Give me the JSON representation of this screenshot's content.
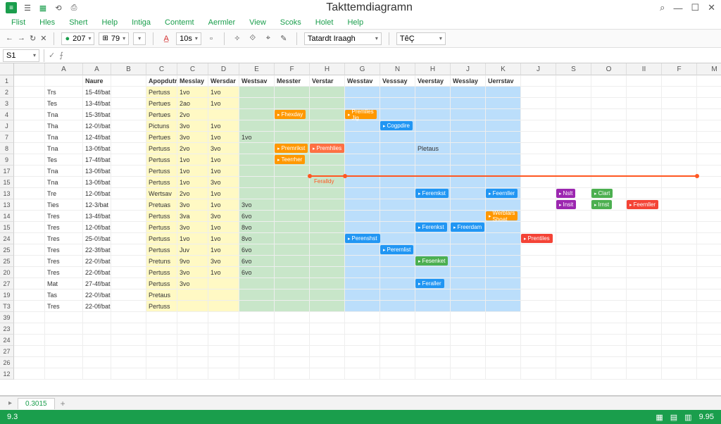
{
  "title": "Takttemdiagramn",
  "menus": [
    "Flist",
    "Hles",
    "Shert",
    "Help",
    "Intiga",
    "Contemt",
    "Aermler",
    "View",
    "Scoks",
    "Holet",
    "Help"
  ],
  "toolbar": {
    "zoom": "207",
    "h": "79",
    "font": "10s",
    "dropdown1": "Tatardt Iraagh",
    "dropdown2": "TêÇ"
  },
  "namebox": "S1",
  "colHeaders": [
    "A",
    "A",
    "B",
    "C",
    "C",
    "D",
    "E",
    "F",
    "H",
    "G",
    "N",
    "H",
    "J",
    "K",
    "J",
    "S",
    "O",
    "II",
    "F",
    "M"
  ],
  "rowNums": [
    "1",
    "2",
    "3",
    "4",
    "J",
    "7",
    "8",
    "9",
    "17",
    "15",
    "13",
    "13",
    "14",
    "15",
    "24",
    "25",
    "25",
    "20",
    "27",
    "19",
    "T3",
    "39",
    "23",
    "24",
    "27",
    "26",
    "12"
  ],
  "headerRow": [
    "",
    "Naure",
    "",
    "Apopdutr",
    "Messlay",
    "Wersdar",
    "Westsav",
    "Messter",
    "Verstar",
    "Wesstav",
    "Vesssay",
    "Veerstay",
    "Wesslay",
    "Uerrstav",
    "",
    "",
    "",
    "",
    "",
    ""
  ],
  "rows": [
    [
      "Trs",
      "15-4f/bat",
      "",
      "Pertuss",
      "1vo",
      "1vo",
      "",
      "",
      "",
      "",
      "",
      "",
      "",
      "",
      "",
      "",
      "",
      "",
      "",
      ""
    ],
    [
      "Tes",
      "13-4f/bat",
      "",
      "Pertues",
      "2ao",
      "1vo",
      "",
      "",
      "",
      "",
      "",
      "",
      "",
      "",
      "",
      "",
      "",
      "",
      "",
      ""
    ],
    [
      "Tna",
      "15-3f/bat",
      "",
      "Pertues",
      "2vo",
      "",
      "",
      "",
      "",
      "",
      "",
      "",
      "",
      "",
      "",
      "",
      "",
      "",
      "",
      ""
    ],
    [
      "Tha",
      "12-0!/bat",
      "",
      "Pictuns",
      "3vo",
      "1vo",
      "",
      "",
      "",
      "",
      "",
      "",
      "",
      "",
      "",
      "",
      "",
      "",
      "",
      ""
    ],
    [
      "Tna",
      "12-4f/bat",
      "",
      "Pertues",
      "3vo",
      "1vo",
      "1vo",
      "",
      "",
      "",
      "",
      "",
      "",
      "",
      "",
      "",
      "",
      "",
      "",
      ""
    ],
    [
      "Tna",
      "13-0f/bat",
      "",
      "Pertuss",
      "2vo",
      "3vo",
      "",
      "",
      "",
      "",
      "",
      "Pletaus",
      "",
      "",
      "",
      "",
      "",
      "",
      "",
      ""
    ],
    [
      "Tes",
      "17-4f/bat",
      "",
      "Pertuss",
      "1vo",
      "1vo",
      "",
      "",
      "",
      "",
      "",
      "",
      "",
      "",
      "",
      "",
      "",
      "",
      "",
      ""
    ],
    [
      "Tna",
      "13-0f/bat",
      "",
      "Pertuss",
      "1vo",
      "1vo",
      "",
      "",
      "",
      "",
      "",
      "",
      "",
      "",
      "",
      "",
      "",
      "",
      "",
      ""
    ],
    [
      "Tna",
      "13-0f/bat",
      "",
      "Pertuss",
      "1vo",
      "3vo",
      "",
      "",
      "",
      "",
      "",
      "",
      "",
      "",
      "",
      "",
      "",
      "",
      "",
      ""
    ],
    [
      "Tre",
      "12-0f/bat",
      "",
      "Wertsav",
      "2vo",
      "1vo",
      "",
      "",
      "",
      "",
      "",
      "",
      "",
      "",
      "",
      "",
      "",
      "",
      "",
      ""
    ],
    [
      "Ties",
      "12-3/bat",
      "",
      "Pretuas",
      "3vo",
      "1vo",
      "3vo",
      "",
      "",
      "",
      "",
      "",
      "",
      "",
      "",
      "",
      "",
      "",
      "",
      ""
    ],
    [
      "Tres",
      "13-4f/bat",
      "",
      "Pertuss",
      "3va",
      "3vo",
      "6vo",
      "",
      "",
      "",
      "",
      "",
      "",
      "",
      "",
      "",
      "",
      "",
      "",
      ""
    ],
    [
      "Tres",
      "12-0f/bat",
      "",
      "Pertuss",
      "3vo",
      "1vo",
      "8vo",
      "",
      "",
      "",
      "",
      "",
      "",
      "",
      "",
      "",
      "",
      "",
      "",
      ""
    ],
    [
      "Tres",
      "25-0!/bat",
      "",
      "Pertuss",
      "1vo",
      "1vo",
      "8vo",
      "",
      "",
      "",
      "",
      "",
      "",
      "",
      "",
      "",
      "",
      "",
      "",
      ""
    ],
    [
      "Tres",
      "22-3f/bat",
      "",
      "Pertuss",
      "Juv",
      "1vo",
      "6vo",
      "",
      "",
      "",
      "",
      "",
      "",
      "",
      "",
      "",
      "",
      "",
      "",
      ""
    ],
    [
      "Tres",
      "22-0!/bat",
      "",
      "Pretuns",
      "9vo",
      "3vo",
      "6vo",
      "",
      "",
      "",
      "",
      "",
      "",
      "",
      "",
      "",
      "",
      "",
      "",
      ""
    ],
    [
      "Tres",
      "22-0f/bat",
      "",
      "Pertuss",
      "3vo",
      "1vo",
      "6vo",
      "",
      "",
      "",
      "",
      "",
      "",
      "",
      "",
      "",
      "",
      "",
      "",
      ""
    ],
    [
      "Mat",
      "27-4f/bat",
      "",
      "Pertuss",
      "3vo",
      "",
      "",
      "",
      "",
      "",
      "",
      "",
      "",
      "",
      "",
      "",
      "",
      "",
      "",
      ""
    ],
    [
      "Tas",
      "22-0!/bat",
      "",
      "Pretaus",
      "",
      "",
      "",
      "",
      "",
      "",
      "",
      "",
      "",
      "",
      "",
      "",
      "",
      "",
      "",
      ""
    ],
    [
      "Tres",
      "22-0f/bat",
      "",
      "Pertuss",
      "",
      "",
      "",
      "",
      "",
      "",
      "",
      "",
      "",
      "",
      "",
      "",
      "",
      "",
      "",
      ""
    ]
  ],
  "tags": [
    {
      "row": 3,
      "col": 7,
      "cls": "orange",
      "t": "Fhexday"
    },
    {
      "row": 3,
      "col": 9,
      "cls": "orange",
      "t": "Premlles  Jig"
    },
    {
      "row": 4,
      "col": 10,
      "cls": "blue",
      "t": "Cogpdire"
    },
    {
      "row": 6,
      "col": 7,
      "cls": "orange",
      "t": "Premrikst"
    },
    {
      "row": 6,
      "col": 8,
      "cls": "orange2",
      "t": "Premhlies"
    },
    {
      "row": 7,
      "col": 7,
      "cls": "orange",
      "t": "Teerrher"
    },
    {
      "row": 10,
      "col": 11,
      "cls": "blue",
      "t": "Feremkst"
    },
    {
      "row": 10,
      "col": 13,
      "cls": "blue",
      "t": "Feernller"
    },
    {
      "row": 10,
      "col": 15,
      "cls": "purple",
      "t": "Nslt"
    },
    {
      "row": 10,
      "col": 16,
      "cls": "green",
      "t": "Clart"
    },
    {
      "row": 11,
      "col": 15,
      "cls": "purple",
      "t": "Insit"
    },
    {
      "row": 11,
      "col": 16,
      "cls": "green",
      "t": "Irnst"
    },
    {
      "row": 11,
      "col": 17,
      "cls": "red",
      "t": "Feernller"
    },
    {
      "row": 12,
      "col": 13,
      "cls": "orange",
      "t": "Werblars Shoat"
    },
    {
      "row": 13,
      "col": 11,
      "cls": "blue",
      "t": "Ferenkst"
    },
    {
      "row": 13,
      "col": 12,
      "cls": "blue",
      "t": "Freerdam"
    },
    {
      "row": 14,
      "col": 9,
      "cls": "blue",
      "t": "Perenshst"
    },
    {
      "row": 14,
      "col": 14,
      "cls": "red",
      "t": "Prentiles"
    },
    {
      "row": 15,
      "col": 10,
      "cls": "blue",
      "t": "Perernlist"
    },
    {
      "row": 16,
      "col": 11,
      "cls": "green",
      "t": "Fesenket"
    },
    {
      "row": 18,
      "col": 11,
      "cls": "blue",
      "t": "Feraller"
    }
  ],
  "timeline": {
    "row": 8,
    "start": 8,
    "end": 19,
    "caption": "Feralldy"
  },
  "sheetTab": "0.3015",
  "status": {
    "left": "9.3",
    "right": "9.95"
  }
}
